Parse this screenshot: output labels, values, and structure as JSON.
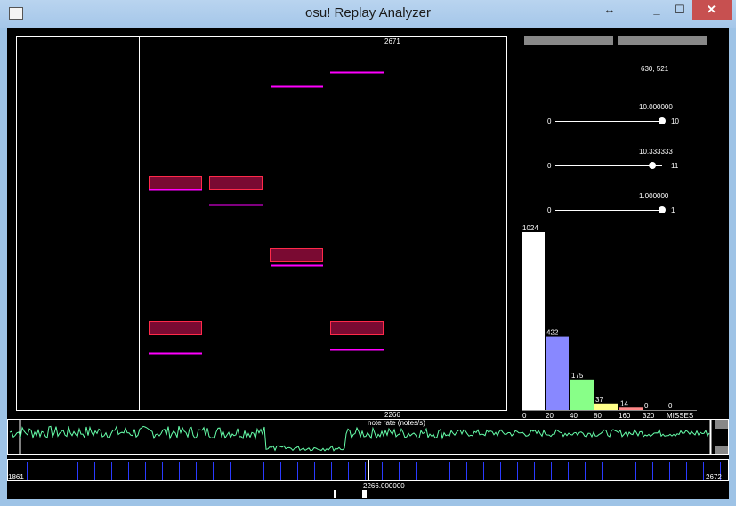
{
  "window": {
    "title": "osu! Replay Analyzer",
    "resize_glyph": "↔",
    "min_glyph": "_",
    "max_glyph": "☐",
    "close_glyph": "✕"
  },
  "timeline": {
    "top_time": "2671",
    "bottom_time": "2266"
  },
  "panel": {
    "coords": "630, 521"
  },
  "sliders": [
    {
      "min": "0",
      "max": "10",
      "value_label": "10.000000",
      "position": 1.0
    },
    {
      "min": "0",
      "max": "11",
      "value_label": "10.333333",
      "position": 0.909
    },
    {
      "min": "0",
      "max": "1",
      "value_label": "1.000000",
      "position": 1.0
    }
  ],
  "histogram": {
    "categories": [
      "0",
      "20",
      "40",
      "80",
      "160",
      "320",
      "MISSES"
    ],
    "values": [
      1024,
      422,
      175,
      37,
      14,
      0,
      0
    ],
    "value_labels": [
      "1024",
      "422",
      "175",
      "37",
      "14",
      "0",
      "0"
    ],
    "colors": [
      "#ffffff",
      "#8888ff",
      "#88ff88",
      "#ffff88",
      "#ff8888",
      "#ff8888",
      "#ff8888"
    ]
  },
  "note_rate": {
    "label": "note rate (notes/s)"
  },
  "bottom": {
    "start": "1861",
    "end": "2672",
    "cursor": "2266.000000"
  },
  "colors": {
    "note_fill": "#7a0a32",
    "note_border": "#ff2a4a",
    "press_line": "#ff00ff",
    "graph": "#66ffaa"
  }
}
